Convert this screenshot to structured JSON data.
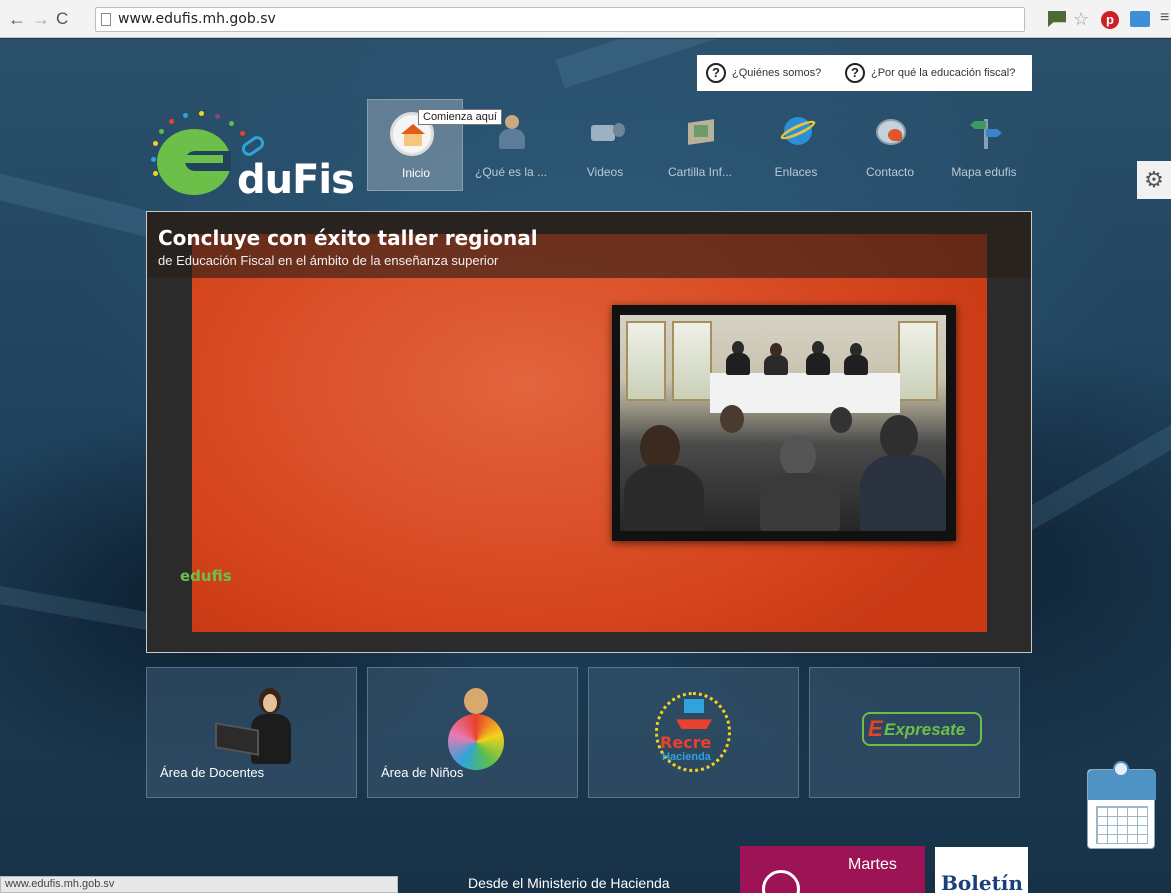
{
  "browser": {
    "url": "www.edufis.mh.gob.sv",
    "status_url": "www.edufis.mh.gob.sv"
  },
  "help_links": [
    {
      "label": "¿Quiénes somos?"
    },
    {
      "label": "¿Por qué la educación fiscal?"
    }
  ],
  "logo": {
    "text": "duFis"
  },
  "nav": {
    "items": [
      {
        "label": "Inicio",
        "icon": "home-icon",
        "active": true
      },
      {
        "label": "¿Qué es la ...",
        "icon": "person-icon"
      },
      {
        "label": "Videos",
        "icon": "video-camera-icon"
      },
      {
        "label": "Cartilla Inf...",
        "icon": "booklet-icon"
      },
      {
        "label": "Enlaces",
        "icon": "internet-explorer-icon"
      },
      {
        "label": "Contacto",
        "icon": "mail-icon"
      },
      {
        "label": "Mapa edufis",
        "icon": "signpost-icon"
      }
    ],
    "tooltip": "Comienza aquí"
  },
  "slider": {
    "title": "Concluye con éxito taller regional",
    "subtitle": "de Educación Fiscal en el ámbito de la enseñanza superior",
    "mini_logo": "edufis"
  },
  "tiles": [
    {
      "label": "Área de Docentes"
    },
    {
      "label": "Área de Niños"
    },
    {
      "label": "Recre Hacienda!",
      "brand_top": "Recre",
      "brand_bottom": "Hacienda"
    },
    {
      "label": "Expresate",
      "brand": "Expresate"
    }
  ],
  "footer": {
    "title": "Desde el Ministerio de Hacienda",
    "martes_label": "Martes",
    "boletin_label": "Boletín"
  },
  "colors": {
    "accent_green": "#6cc04a",
    "slide_orange": "#d6461f",
    "martes_magenta": "#9c1356"
  }
}
